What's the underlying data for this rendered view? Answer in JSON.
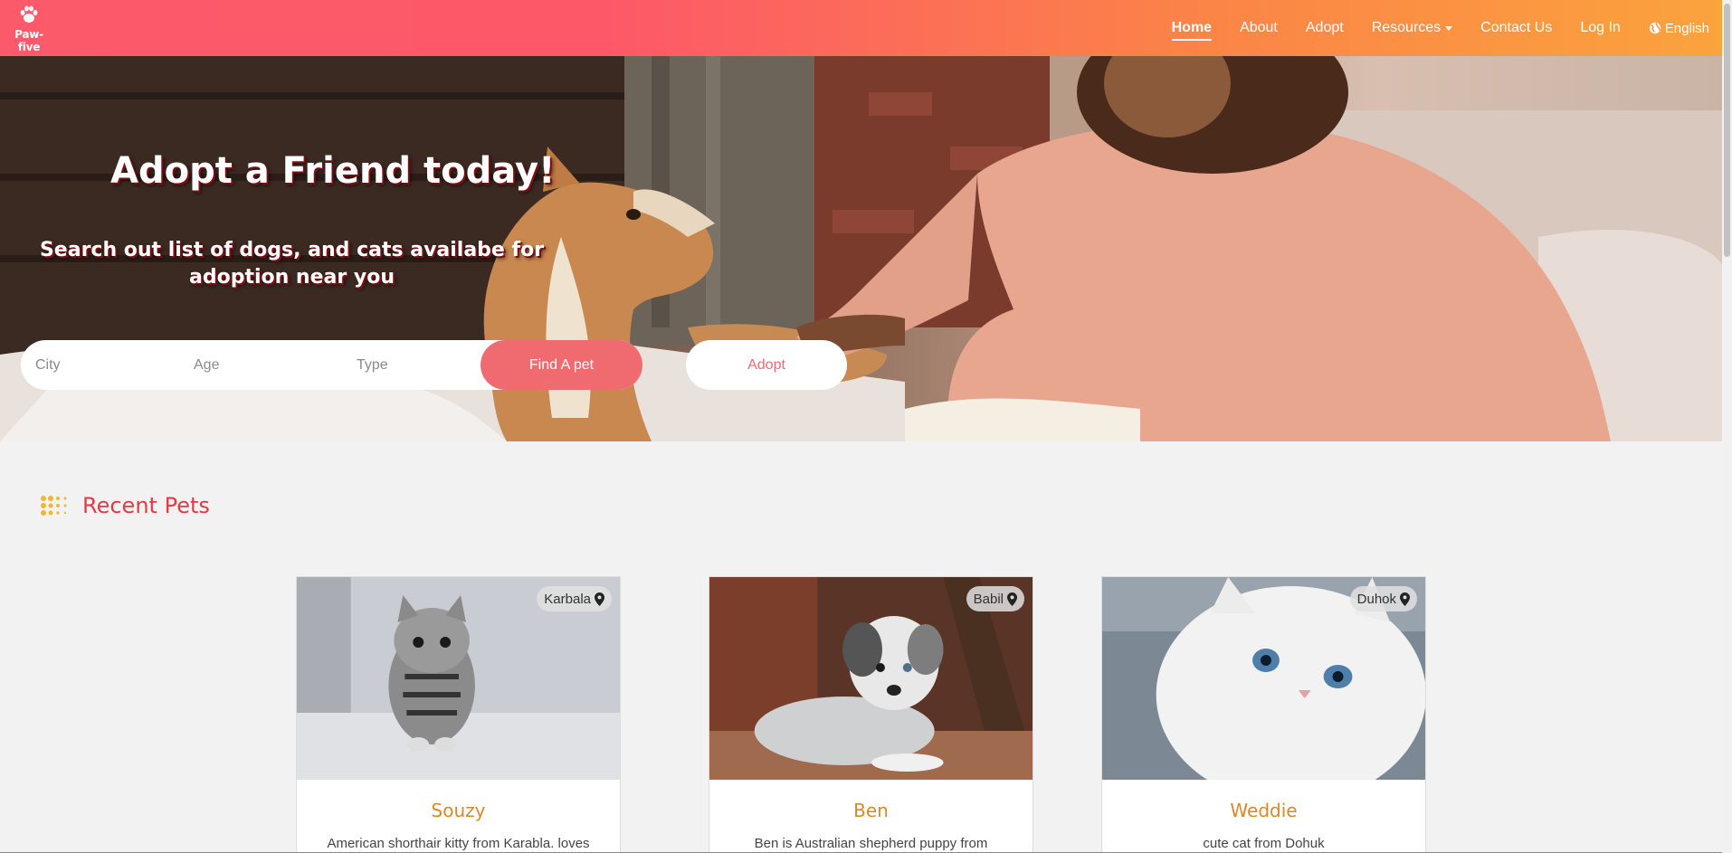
{
  "brand": {
    "name": "Paw-five",
    "logo_icon": "paw-icon"
  },
  "nav": {
    "items": [
      {
        "label": "Home",
        "active": true
      },
      {
        "label": "About"
      },
      {
        "label": "Adopt"
      },
      {
        "label": "Resources",
        "dropdown": true
      },
      {
        "label": "Contact Us"
      },
      {
        "label": "Log In"
      }
    ],
    "language": {
      "label": "English",
      "icon": "globe-icon"
    }
  },
  "hero": {
    "title": "Adopt a Friend today!",
    "subtitle": "Search out list of dogs, and cats availabe for adoption near you",
    "search": {
      "city_placeholder": "City",
      "age_placeholder": "Age",
      "type_placeholder": "Type",
      "find_label": "Find A pet"
    },
    "adopt_label": "Adopt"
  },
  "recent": {
    "title": "Recent Pets",
    "cards": [
      {
        "name": "Souzy",
        "location": "Karbala",
        "description": "American shorthair kitty from Karabla. loves"
      },
      {
        "name": "Ben",
        "location": "Babil",
        "description": "Ben is Australian shepherd puppy from"
      },
      {
        "name": "Weddie",
        "location": "Duhok",
        "description": "cute cat from Dohuk"
      }
    ]
  },
  "colors": {
    "nav_gradient_start": "#fb5a6a",
    "nav_gradient_end": "#fba33d",
    "accent_button": "#f06b70",
    "section_title": "#e33b45",
    "card_name": "#d9892a"
  }
}
